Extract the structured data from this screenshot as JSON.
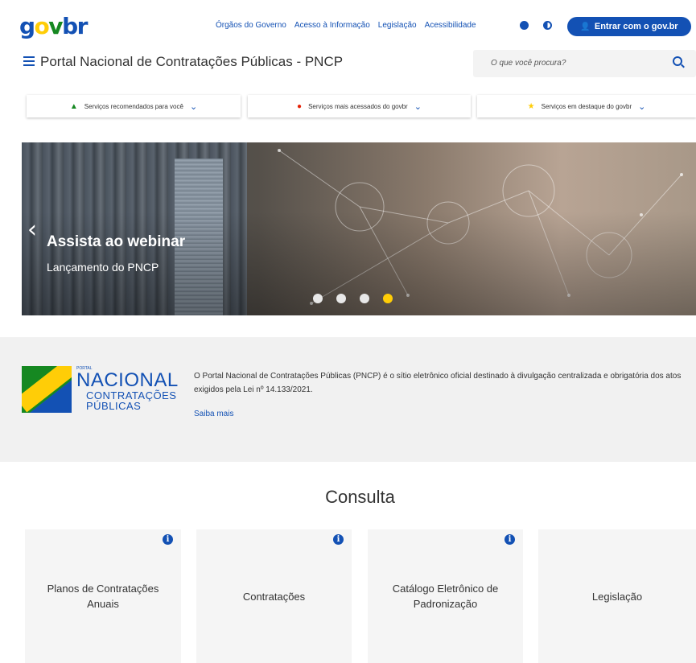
{
  "header": {
    "logo": {
      "g": "g",
      "o": "o",
      "v": "v",
      "b": "br"
    },
    "links": [
      "Órgãos do Governo",
      "Acesso à Informação",
      "Legislação",
      "Acessibilidade"
    ],
    "login_label": "Entrar com o gov.br"
  },
  "subheader": {
    "portal_title": "Portal Nacional de Contratações Públicas - PNCP",
    "search_placeholder": "O que você procura?"
  },
  "services": [
    {
      "label": "Serviços recomendados para você",
      "icon": "thumb-up-icon",
      "color": "#168821"
    },
    {
      "label": "Serviços mais acessados do govbr",
      "icon": "fire-icon",
      "color": "#e52207"
    },
    {
      "label": "Serviços em destaque do govbr",
      "icon": "star-icon",
      "color": "#ffcd07"
    }
  ],
  "banner": {
    "title": "Assista ao webinar",
    "subtitle": "Lançamento do PNCP",
    "slides": 4,
    "active_slide": 4
  },
  "about": {
    "logo": {
      "small": "PORTAL",
      "nacional": "NACIONAL",
      "contratacoes": "CONTRATAÇÕES",
      "publicas": "PÚBLICAS"
    },
    "text": "O Portal Nacional de Contratações Públicas (PNCP) é o sítio eletrônico oficial destinado à divulgação centralizada e obrigatória dos atos exigidos pela Lei nº 14.133/2021.",
    "link": "Saiba mais"
  },
  "consulta": {
    "title": "Consulta",
    "cards": [
      {
        "label": "Planos de Contratações Anuais",
        "info": true
      },
      {
        "label": "Contratações",
        "info": true
      },
      {
        "label": "Catálogo Eletrônico de Padronização",
        "info": true
      },
      {
        "label": "Legislação",
        "info": false
      }
    ]
  },
  "colors": {
    "primary": "#1351b4",
    "yellow": "#ffcd07",
    "green": "#168821"
  }
}
